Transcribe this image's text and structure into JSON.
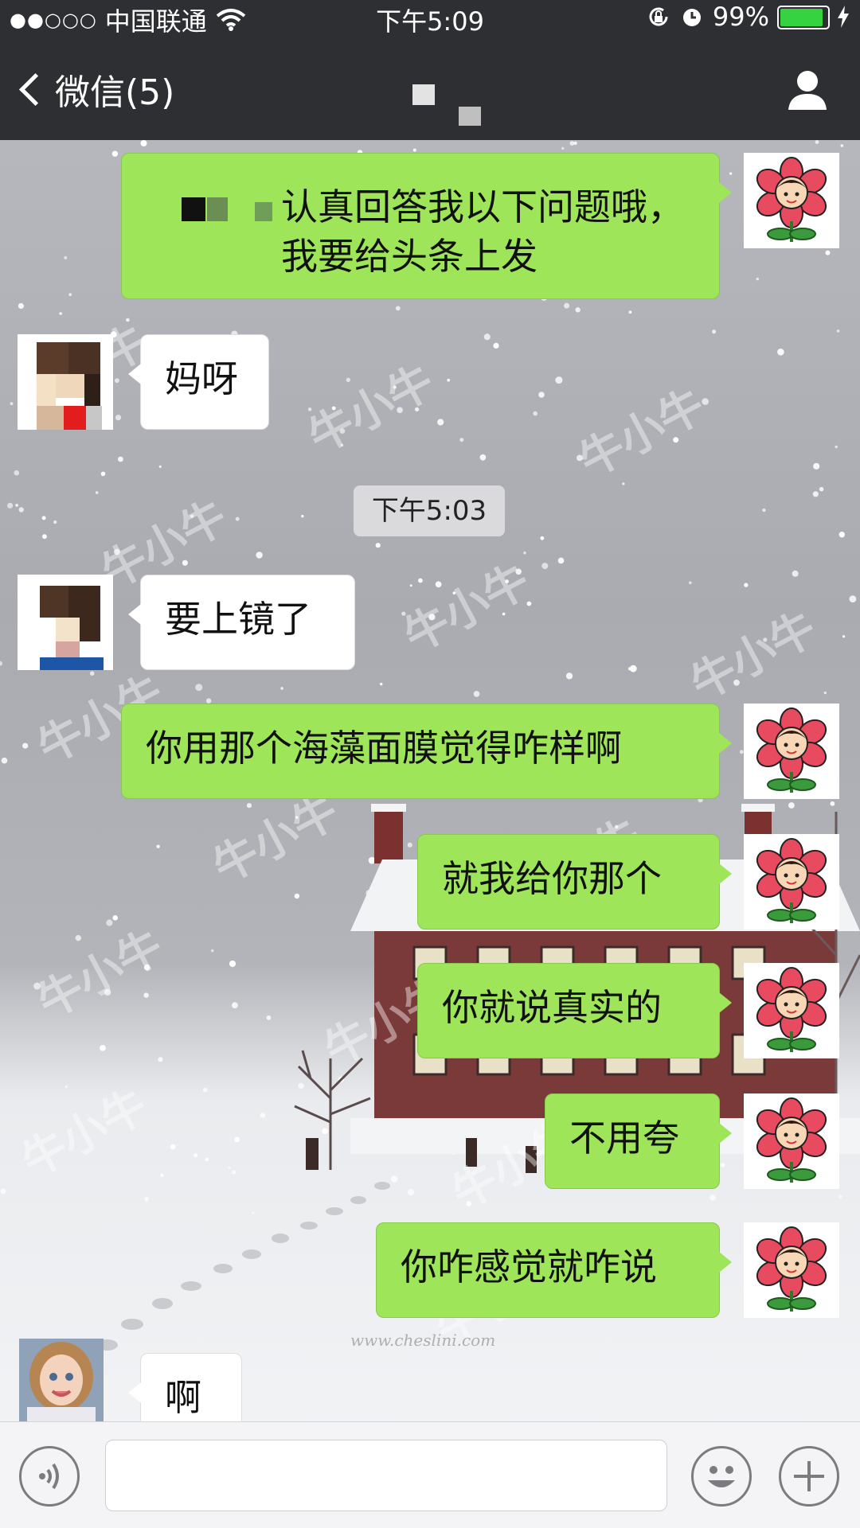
{
  "status_bar": {
    "signal_dots": "●●○○○",
    "carrier": "中国联通",
    "time": "下午5:09",
    "battery_percent": "99%",
    "battery_level": 0.99
  },
  "nav": {
    "back_label": "微信(5)"
  },
  "messages": [
    {
      "side": "out",
      "text": "认真回答我以下问题哦，我要给头条上发"
    },
    {
      "side": "in",
      "text": "妈呀"
    },
    {
      "side": "in",
      "text": "要上镜了"
    },
    {
      "side": "out",
      "text": "你用那个海藻面膜觉得咋样啊"
    },
    {
      "side": "out",
      "text": "就我给你那个"
    },
    {
      "side": "out",
      "text": "你就说真实的"
    },
    {
      "side": "out",
      "text": "不用夸"
    },
    {
      "side": "out",
      "text": "你咋感觉就咋说"
    },
    {
      "side": "in",
      "text": "啊"
    }
  ],
  "timestamp": "下午5:03",
  "watermark_text": "牛小牛",
  "site_mark": "www.cheslini.com",
  "input": {
    "placeholder": ""
  },
  "colors": {
    "header": "#2e2f33",
    "bubble_out": "#9fe55a",
    "bubble_in": "#ffffff",
    "battery": "#35d33f"
  },
  "icons": [
    "voice-icon",
    "emoji-icon",
    "plus-icon",
    "profile-icon",
    "wifi-icon",
    "lock-rotation-icon",
    "alarm-icon",
    "charging-icon",
    "back-chevron-icon"
  ]
}
